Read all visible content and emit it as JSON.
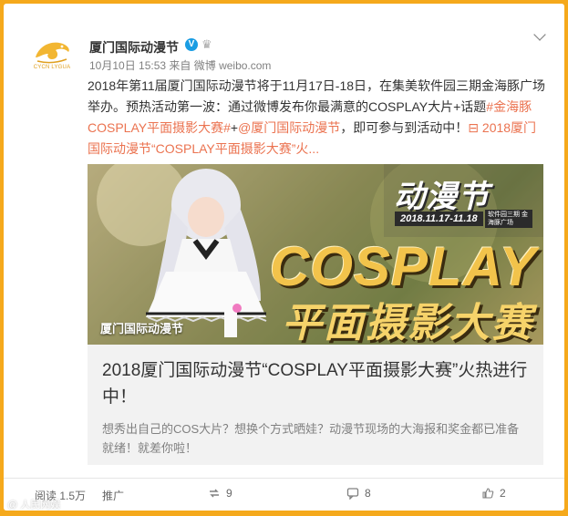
{
  "post": {
    "account_name": "厦门国际动漫节",
    "avatar_caption": "CYCN LYGUA",
    "meta_time": "10月10日 15:53",
    "meta_source": "来自 微博 weibo.com",
    "text_main": "2018年第11届厦门国际动漫节将于11月17日-18日，在集美软件园三期金海豚广场举办。预热活动第一波：通过微博发布你最满意的COSPLAY大片+话题",
    "hashtag": "#金海豚COSPLAY平面摄影大赛#",
    "text_plus": "+",
    "mention": "@厦门国际动漫节",
    "text_after": "，即可参与到活动中！",
    "topic_link": "⊟ 2018厦门国际动漫节“COSPLAY平面摄影大赛”火..."
  },
  "hero": {
    "title_top": "动漫节",
    "date": "2018.11.17-11.18",
    "venue": "软件园三期 金海豚广场",
    "title_cosplay": "COSPLAY",
    "title_bottom": "平面摄影大赛",
    "brand": "厦门国际动漫节"
  },
  "card": {
    "title": "2018厦门国际动漫节“COSPLAY平面摄影大赛”火热进行中！",
    "description": "想秀出自己的COS大片？想换个方式晒娃？动漫节现场的大海报和奖金都已准备就绪！就差你啦！"
  },
  "footer": {
    "views": "阅读 1.5万",
    "promote": "推广",
    "reposts": "9",
    "comments": "8",
    "likes": "2"
  },
  "watermark": "@ 人民网娱",
  "colors": {
    "frame": "#f5a91c",
    "link": "#eb7350",
    "verified": "#1a9de3"
  },
  "icons": [
    "verified-icon",
    "crown-icon",
    "chevron-down-icon",
    "repost-icon",
    "comment-icon",
    "like-icon"
  ]
}
